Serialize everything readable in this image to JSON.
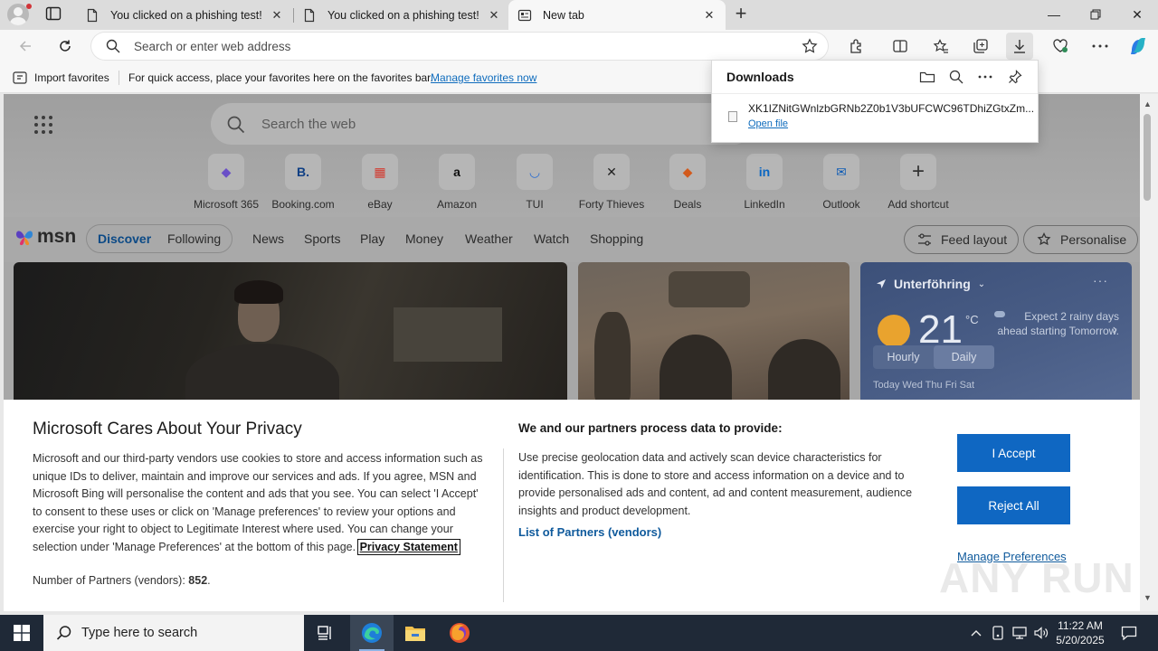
{
  "browser": {
    "tabs": [
      {
        "title": "You clicked on a phishing test!",
        "active": false
      },
      {
        "title": "You clicked on a phishing test!",
        "active": false
      },
      {
        "title": "New tab",
        "active": true
      }
    ],
    "address_placeholder": "Search or enter web address"
  },
  "favorites_bar": {
    "import_label": "Import favorites",
    "message": "For quick access, place your favorites here on the favorites bar.",
    "manage_link": "Manage favorites now"
  },
  "downloads": {
    "title": "Downloads",
    "file_name": "XK1IZNitGWnlzbGRNb2Z0b1V3bUFCWC96TDhiZGtxZm...",
    "open_file": "Open file"
  },
  "newtab": {
    "search_placeholder": "Search the web",
    "shortcuts": [
      {
        "label": "Microsoft 365",
        "icon": "microsoft-365-icon",
        "glyph": "◆",
        "color": "#6a4fc7"
      },
      {
        "label": "Booking.com",
        "icon": "booking-icon",
        "glyph": "B.",
        "color": "#0f3f84"
      },
      {
        "label": "eBay",
        "icon": "ebay-icon",
        "glyph": "▦",
        "color": "#d33a2f"
      },
      {
        "label": "Amazon",
        "icon": "amazon-icon",
        "glyph": "a",
        "color": "#111111"
      },
      {
        "label": "TUI",
        "icon": "tui-icon",
        "glyph": "◡",
        "color": "#2e6fd1"
      },
      {
        "label": "Forty Thieves",
        "icon": "forty-thieves-icon",
        "glyph": "✕",
        "color": "#222222"
      },
      {
        "label": "Deals",
        "icon": "deals-icon",
        "glyph": "◆",
        "color": "#d25a1c"
      },
      {
        "label": "LinkedIn",
        "icon": "linkedin-icon",
        "glyph": "in",
        "color": "#0a66c2"
      },
      {
        "label": "Outlook",
        "icon": "outlook-icon",
        "glyph": "✉",
        "color": "#0f5cb5"
      },
      {
        "label": "Add shortcut",
        "icon": "plus-icon",
        "glyph": "+",
        "color": "#333333"
      }
    ]
  },
  "msn": {
    "logo": "msn",
    "tabs": [
      "Discover",
      "Following"
    ],
    "nav": [
      "News",
      "Sports",
      "Play",
      "Money",
      "Weather",
      "Watch",
      "Shopping"
    ],
    "feed_layout": "Feed layout",
    "personalise": "Personalise"
  },
  "weather": {
    "location": "Unterföhring",
    "temperature": "21",
    "unit": "°C",
    "forecast": "Expect 2 rainy days ahead starting Tomorrow.",
    "modes": [
      "Hourly",
      "Daily"
    ],
    "days_partial": "Today    Wed    Thu    Fri    Sat"
  },
  "privacy": {
    "title": "Microsoft Cares About Your Privacy",
    "body": "Microsoft and our third-party vendors use cookies to store and access information such as unique IDs to deliver, maintain and improve our services and ads. If you agree, MSN and Microsoft Bing will personalise the content and ads that you see. You can select 'I Accept' to consent to these uses or click on 'Manage preferences' to review your options and exercise your right to object to Legitimate Interest where used.  You can change your selection under 'Manage Preferences' at the bottom of this page.",
    "privacy_link": "Privacy Statement",
    "partners_label": "Number of Partners (vendors):",
    "partners_count": "852",
    "partners_suffix": ".",
    "right_title": "We and our partners process data to provide:",
    "right_body": "Use precise geolocation data and actively scan device characteristics for identification. This is done to store and access information on a device and to provide personalised ads and content, ad and content measurement, audience insights and product development.",
    "vendors_link": "List of Partners (vendors)",
    "accept": "I Accept",
    "reject": "Reject All",
    "manage": "Manage Preferences"
  },
  "watermark": "ANY RUN",
  "taskbar": {
    "search_placeholder": "Type here to search",
    "time": "11:22 AM",
    "date": "5/20/2025"
  }
}
